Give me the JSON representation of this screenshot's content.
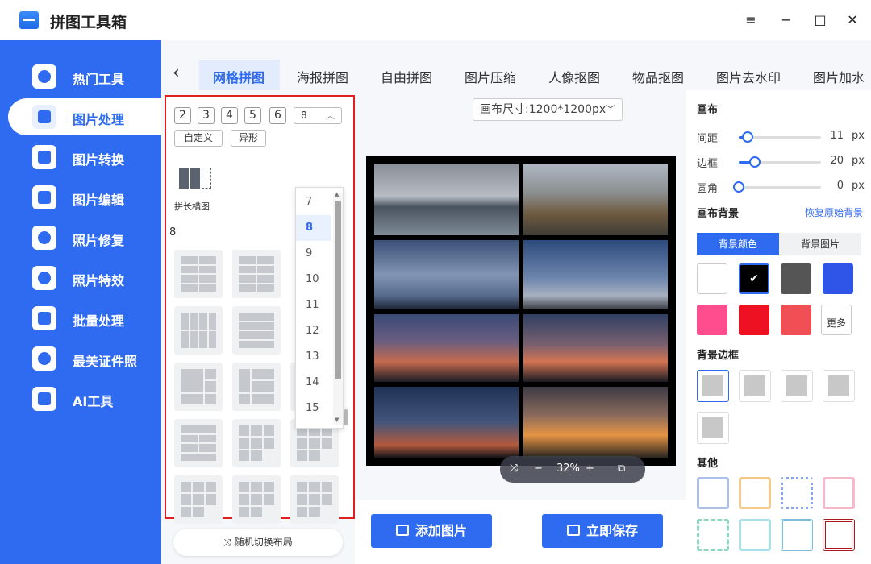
{
  "app": {
    "title": "拼图工具箱"
  },
  "window": {
    "menu_icon": "≡",
    "min_icon": "−",
    "max_icon": "□",
    "close_icon": "✕"
  },
  "sidebar": {
    "items": [
      {
        "label": "热门工具",
        "icon": "tools-icon",
        "active": false
      },
      {
        "label": "图片处理",
        "icon": "image-process-icon",
        "active": true
      },
      {
        "label": "图片转换",
        "icon": "image-convert-icon",
        "active": false
      },
      {
        "label": "图片编辑",
        "icon": "image-edit-icon",
        "active": false
      },
      {
        "label": "照片修复",
        "icon": "photo-repair-icon",
        "active": false
      },
      {
        "label": "照片特效",
        "icon": "photo-effects-icon",
        "active": false
      },
      {
        "label": "批量处理",
        "icon": "batch-icon",
        "active": false
      },
      {
        "label": "最美证件照",
        "icon": "id-photo-icon",
        "active": false
      },
      {
        "label": "AI工具",
        "icon": "ai-icon",
        "active": false
      }
    ]
  },
  "tabs": {
    "back_icon": "‹",
    "items": [
      "网格拼图",
      "海报拼图",
      "自由拼图",
      "图片压缩",
      "人像抠图",
      "物品抠图",
      "图片去水印",
      "图片加水"
    ],
    "active_index": 0
  },
  "layout_panel": {
    "counts": [
      "2",
      "3",
      "4",
      "5",
      "6"
    ],
    "select_value": "8",
    "select_chevron": "︿",
    "custom_label": "自定义",
    "irregular_label": "异形",
    "long_image_label": "拼长横图",
    "section_count": "8",
    "dropdown_options": [
      "7",
      "8",
      "9",
      "10",
      "11",
      "12",
      "13",
      "14",
      "15"
    ],
    "dropdown_selected": "8",
    "shuffle_label": "随机切换布局"
  },
  "canvas": {
    "size_label": "画布尺寸:1200*1200px",
    "size_chevron": "﹀",
    "zoom": "32%",
    "zoom_shuffle_icon": "⤨",
    "zoom_minus": "−",
    "zoom_plus": "+",
    "zoom_fit_icon": "⧉"
  },
  "settings": {
    "canvas_title": "画布",
    "spacing_label": "间距",
    "spacing_value": "11",
    "spacing_fraction": 0.11,
    "border_label": "边框",
    "border_value": "20",
    "border_fraction": 0.2,
    "radius_label": "圆角",
    "radius_value": "0",
    "radius_fraction": 0.0,
    "unit": "px",
    "bg_title": "画布背景",
    "restore_label": "恢复原始背景",
    "bg_color_tab": "背景颜色",
    "bg_image_tab": "背景图片",
    "colors": [
      "#ffffff",
      "#000000",
      "#555555",
      "#2f55e8",
      "#ff4d8d",
      "#ee1122",
      "#f05055"
    ],
    "selected_color": "#000000",
    "check_icon": "✔",
    "more_label": "更多",
    "bg_border_title": "背景边框",
    "other_title": "其他"
  },
  "actions": {
    "add_image": "添加图片",
    "save_now": "立即保存"
  }
}
